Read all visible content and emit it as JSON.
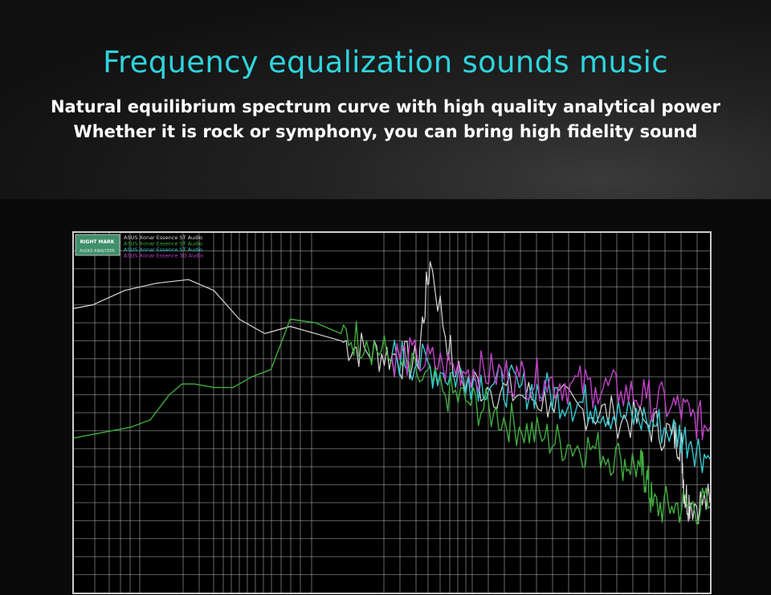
{
  "header": {
    "title": "Frequency equalization sounds music",
    "subtitle_line1": "Natural equilibrium spectrum curve with high quality analytical power",
    "subtitle_line2": "Whether it is rock or symphony, you can bring high fidelity sound"
  },
  "colors": {
    "title": "#2fd3dc",
    "grid": "#bdbdbd",
    "series": [
      "#d9d9d9",
      "#3fae3f",
      "#35c8d0",
      "#c143c8"
    ]
  },
  "chart_data": {
    "type": "line",
    "logo_text": "RIGHT MARK",
    "logo_subtext": "AUDIO ANALYZER",
    "grid": true,
    "legend_position": "top-left",
    "series": [
      {
        "name": "ASUS Xonar Essence ST Audio",
        "color": "#d9d9d9",
        "x": [
          0,
          0.03,
          0.08,
          0.13,
          0.18,
          0.22,
          0.26,
          0.3,
          0.34,
          0.38,
          0.42,
          0.46,
          0.5,
          0.54,
          0.56,
          0.6,
          0.65,
          0.7,
          0.75,
          0.8,
          0.85,
          0.9,
          0.94,
          0.955,
          0.96,
          0.97,
          1
        ],
        "y": [
          0.79,
          0.8,
          0.84,
          0.86,
          0.87,
          0.84,
          0.76,
          0.72,
          0.74,
          0.72,
          0.7,
          0.67,
          0.66,
          0.63,
          0.92,
          0.6,
          0.57,
          0.55,
          0.53,
          0.51,
          0.49,
          0.47,
          0.44,
          0.42,
          0.27,
          0.25,
          0.25
        ]
      },
      {
        "name": "ASUS Xonar Essence ST Audio",
        "color": "#3fae3f",
        "x": [
          0,
          0.03,
          0.06,
          0.09,
          0.12,
          0.15,
          0.17,
          0.19,
          0.22,
          0.25,
          0.28,
          0.31,
          0.34,
          0.38,
          0.42,
          0.46,
          0.5,
          0.54,
          0.58,
          0.62,
          0.66,
          0.7,
          0.74,
          0.78,
          0.82,
          0.86,
          0.89,
          0.9,
          0.91,
          0.94,
          0.97,
          1
        ],
        "y": [
          0.43,
          0.44,
          0.45,
          0.46,
          0.48,
          0.55,
          0.58,
          0.58,
          0.57,
          0.57,
          0.6,
          0.62,
          0.76,
          0.75,
          0.72,
          0.7,
          0.65,
          0.6,
          0.56,
          0.53,
          0.5,
          0.46,
          0.43,
          0.41,
          0.4,
          0.37,
          0.35,
          0.32,
          0.24,
          0.24,
          0.24,
          0.24
        ]
      },
      {
        "name": "ASUS Xonar Essence ST Audio",
        "color": "#35c8d0",
        "x": [
          0.5,
          0.54,
          0.58,
          0.62,
          0.66,
          0.7,
          0.74,
          0.78,
          0.82,
          0.86,
          0.9,
          0.94,
          0.97,
          1
        ],
        "y": [
          0.66,
          0.64,
          0.61,
          0.6,
          0.58,
          0.57,
          0.56,
          0.53,
          0.52,
          0.49,
          0.48,
          0.45,
          0.42,
          0.37
        ]
      },
      {
        "name": "ASUS Xonar Essence 3D Audio",
        "color": "#c143c8",
        "x": [
          0.5,
          0.54,
          0.58,
          0.62,
          0.66,
          0.7,
          0.74,
          0.78,
          0.82,
          0.86,
          0.9,
          0.94,
          0.97,
          1
        ],
        "y": [
          0.66,
          0.65,
          0.63,
          0.62,
          0.61,
          0.6,
          0.59,
          0.58,
          0.57,
          0.56,
          0.54,
          0.52,
          0.49,
          0.46
        ]
      }
    ]
  }
}
